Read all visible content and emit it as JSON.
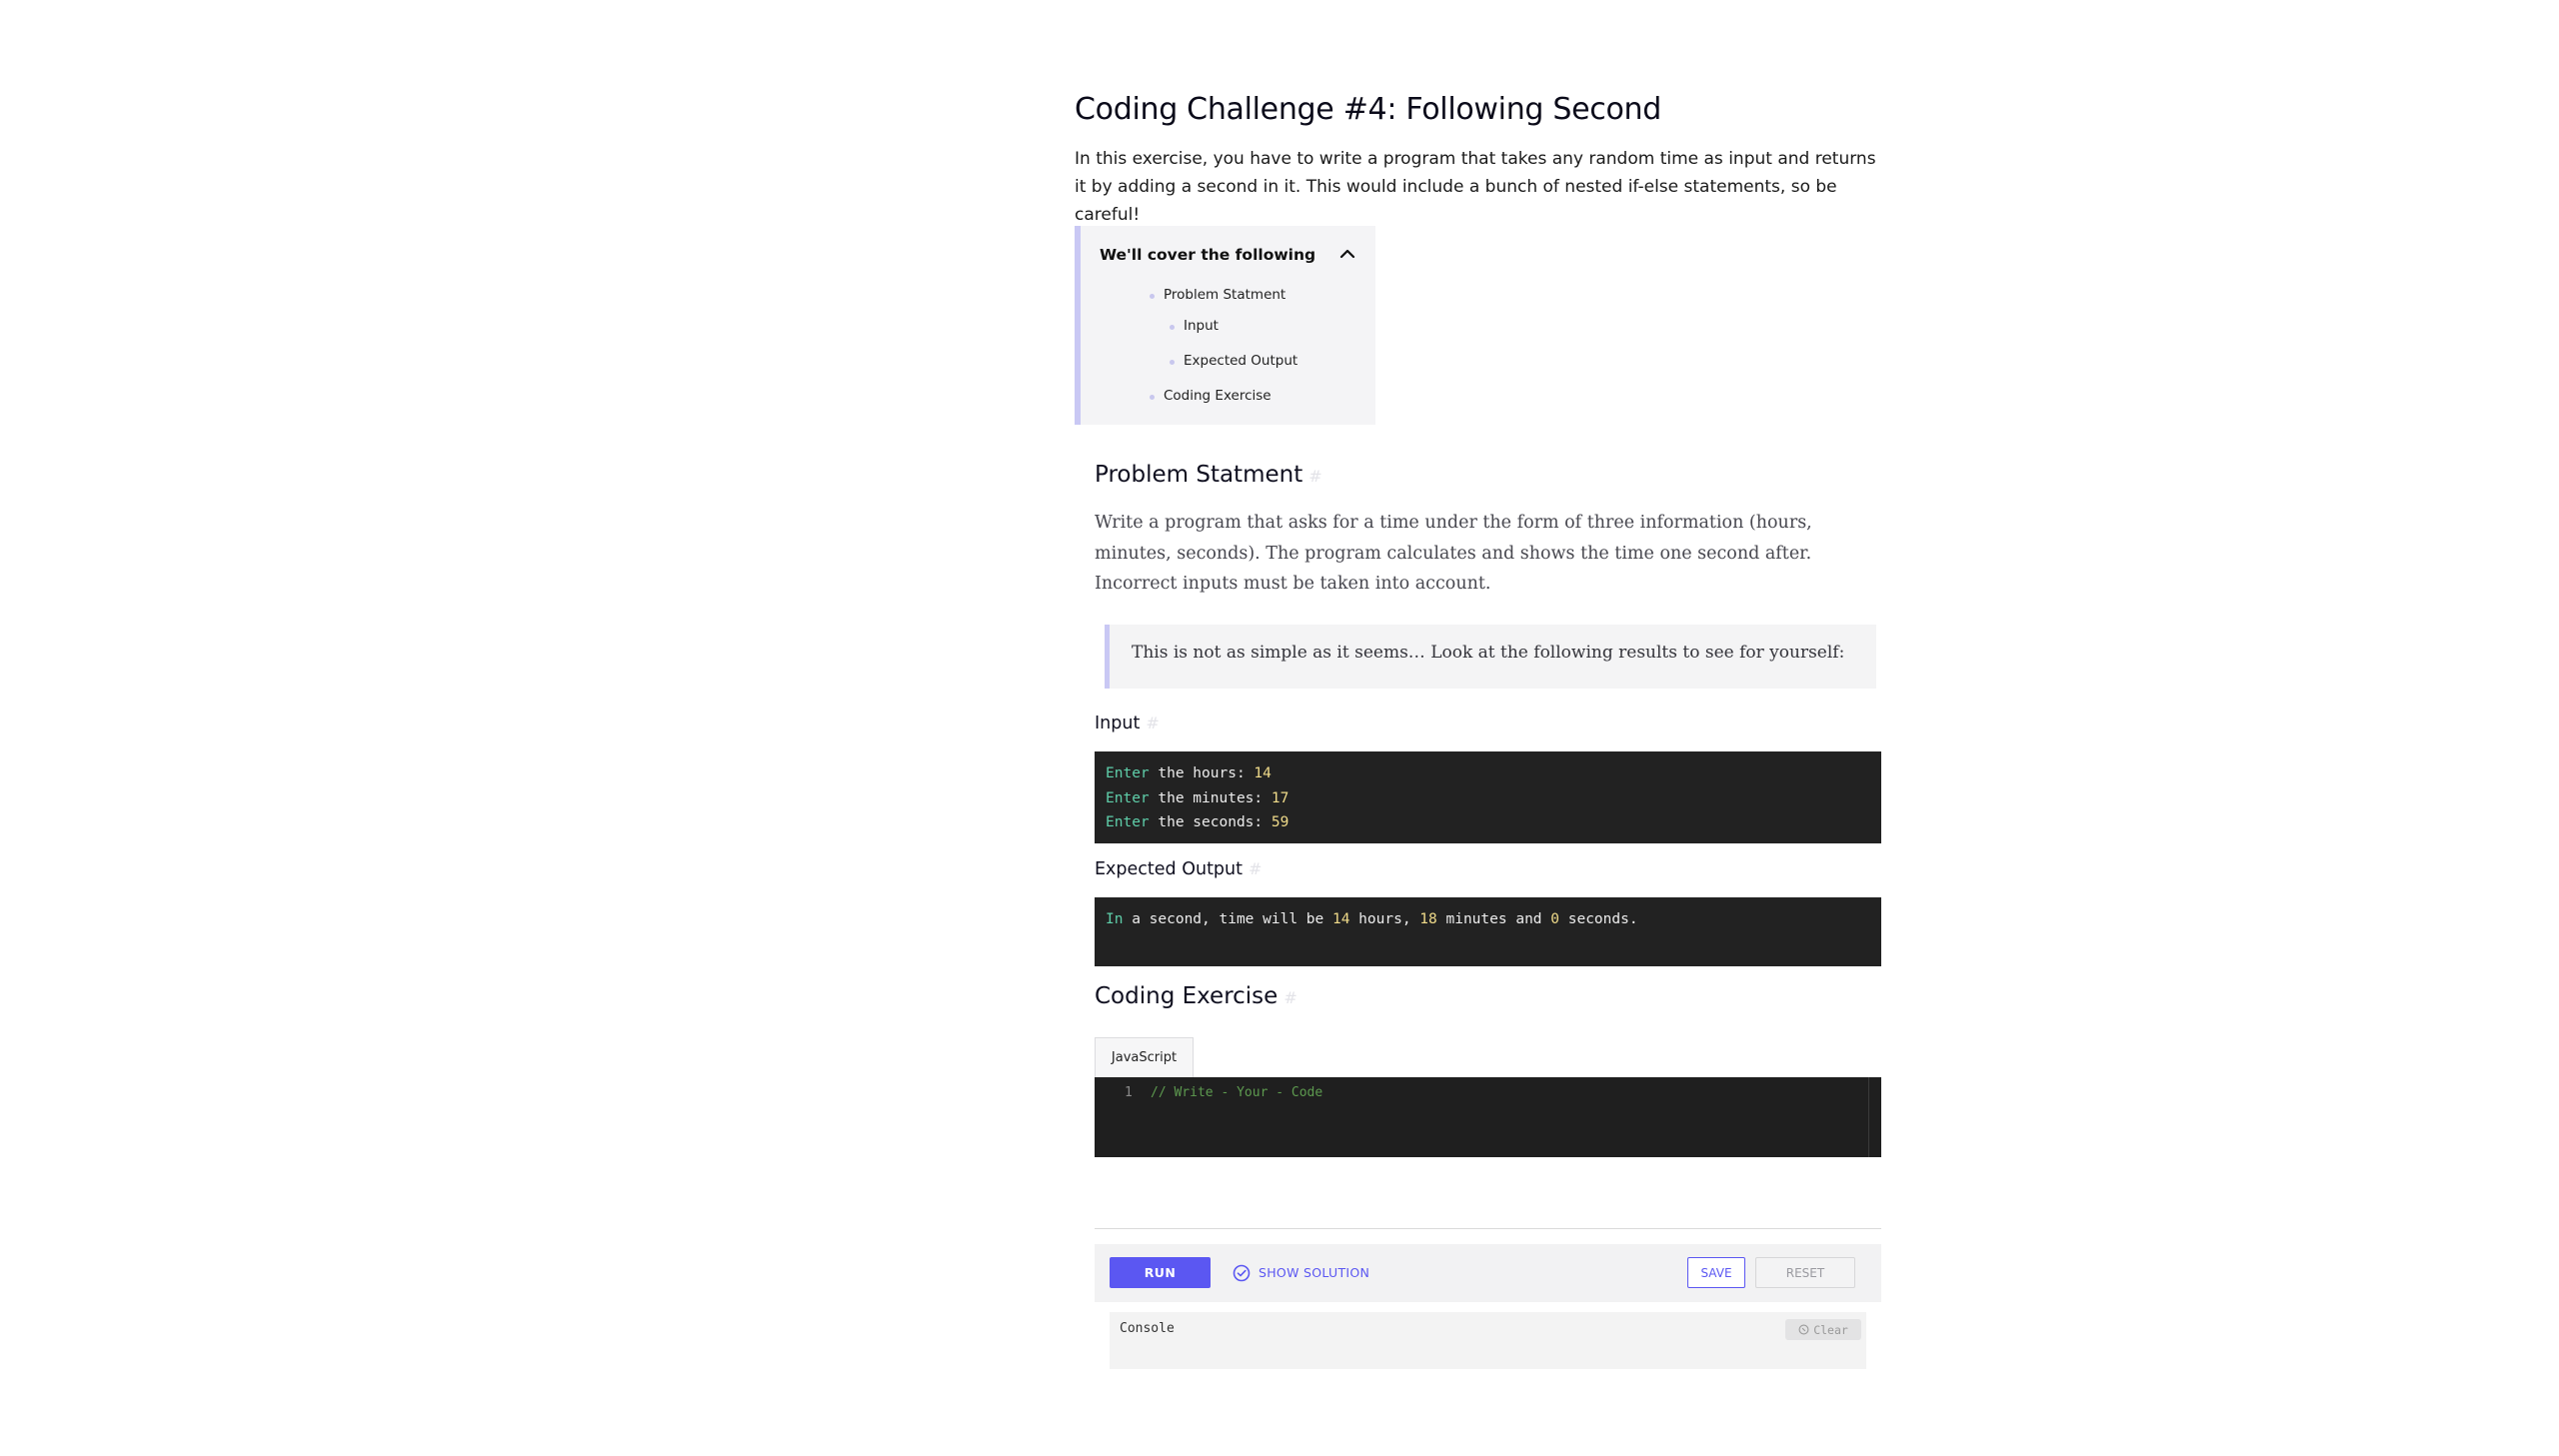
{
  "title": "Coding Challenge #4: Following Second",
  "intro": "In this exercise, you have to write a program that takes any random time as input and returns it by adding a second in it. This would include a bunch of nested if-else statements, so be careful!",
  "toc": {
    "heading": "We'll cover the following",
    "items": [
      "Problem Statment",
      "Input",
      "Expected Output",
      "Coding Exercise"
    ]
  },
  "problem": {
    "heading": "Problem Statment",
    "text": "Write a program that asks for a time under the form of three information (hours, minutes, seconds). The program calculates and shows the time one second after. Incorrect inputs must be taken into account.",
    "quote": "This is not as simple as it seems… Look at the following results to see for yourself:"
  },
  "input": {
    "heading": "Input",
    "lines": [
      {
        "kw": "Enter",
        "text": " the hours: ",
        "num": "14"
      },
      {
        "kw": "Enter",
        "text": " the minutes: ",
        "num": "17"
      },
      {
        "kw": "Enter",
        "text": " the seconds: ",
        "num": "59"
      }
    ]
  },
  "output": {
    "heading": "Expected Output",
    "parts": [
      {
        "kw": "In"
      },
      {
        "text": " a second, time will be "
      },
      {
        "num": "14"
      },
      {
        "text": " hours, "
      },
      {
        "num": "18"
      },
      {
        "text": " minutes and "
      },
      {
        "num": "0"
      },
      {
        "text": " seconds."
      }
    ]
  },
  "exercise": {
    "heading": "Coding Exercise",
    "language_tab": "JavaScript",
    "line_number": "1",
    "code": "// Write - Your - Code"
  },
  "toolbar": {
    "run_label": "RUN",
    "solution_label": "SHOW SOLUTION",
    "save_label": "SAVE",
    "reset_label": "RESET"
  },
  "console": {
    "label": "Console",
    "clear_label": "Clear"
  },
  "colors": {
    "accent": "#5b57f2",
    "toc_border": "#c9c8f4",
    "code_bg": "#222222",
    "keyword": "#5fcfaa",
    "number": "#f0db8a"
  }
}
